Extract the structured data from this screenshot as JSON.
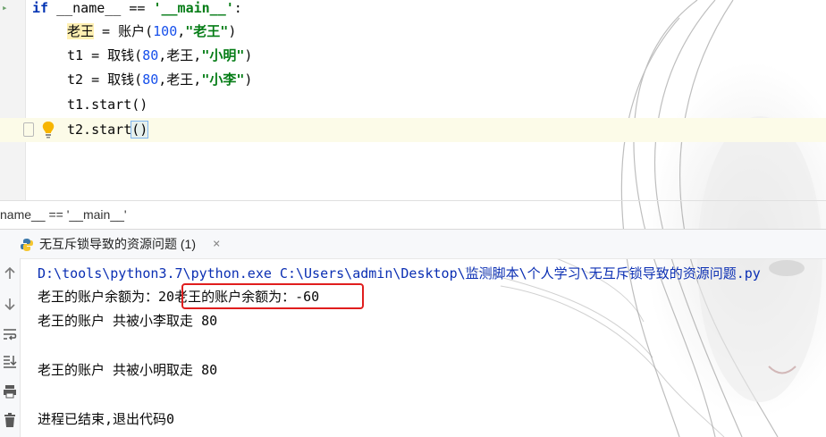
{
  "editor": {
    "lines": [
      {
        "indent": "",
        "kw": "if",
        "rest1": " __name__ == ",
        "str": "'__main__'",
        "rest2": ":"
      },
      {
        "indent": "    ",
        "hl": "老王",
        "p1": " = 账户(",
        "num": "100",
        "p2": ",",
        "str": "\"老王\"",
        "p3": ")"
      },
      {
        "indent": "    ",
        "p1": "t1 = 取钱(",
        "num": "80",
        "p2": ",老王,",
        "str": "\"小明\"",
        "p3": ")"
      },
      {
        "indent": "    ",
        "p1": "t2 = 取钱(",
        "num": "80",
        "p2": ",老王,",
        "str": "\"小李\"",
        "p3": ")"
      },
      {
        "indent": "    ",
        "p1": "t1.start()"
      },
      {
        "indent": "    ",
        "p1": "t2.start",
        "paren": "()"
      }
    ]
  },
  "breadcrumb": "name__ == '__main__'",
  "run_panel": {
    "tab_label": "无互斥锁导致的资源问题 (1)",
    "close_label": "×",
    "console": {
      "command": "D:\\tools\\python3.7\\python.exe C:\\Users\\admin\\Desktop\\监测脚本\\个人学习\\无互斥锁导致的资源问题.py",
      "line1": "老王的账户余额为：20老王的账户余额为：-60",
      "line2": "老王的账户 共被小李取走 80",
      "line3": "老王的账户 共被小明取走 80",
      "line4": "进程已结束,退出代码0"
    }
  },
  "toolbar_icons": [
    "arrow-up-icon",
    "arrow-down-icon",
    "soft-wrap-icon",
    "scroll-to-end-icon",
    "print-icon",
    "trash-icon"
  ],
  "colors": {
    "keyword": "#0033b3",
    "string": "#067d17",
    "number": "#1750eb",
    "highlight_box": "#e01e1e"
  }
}
